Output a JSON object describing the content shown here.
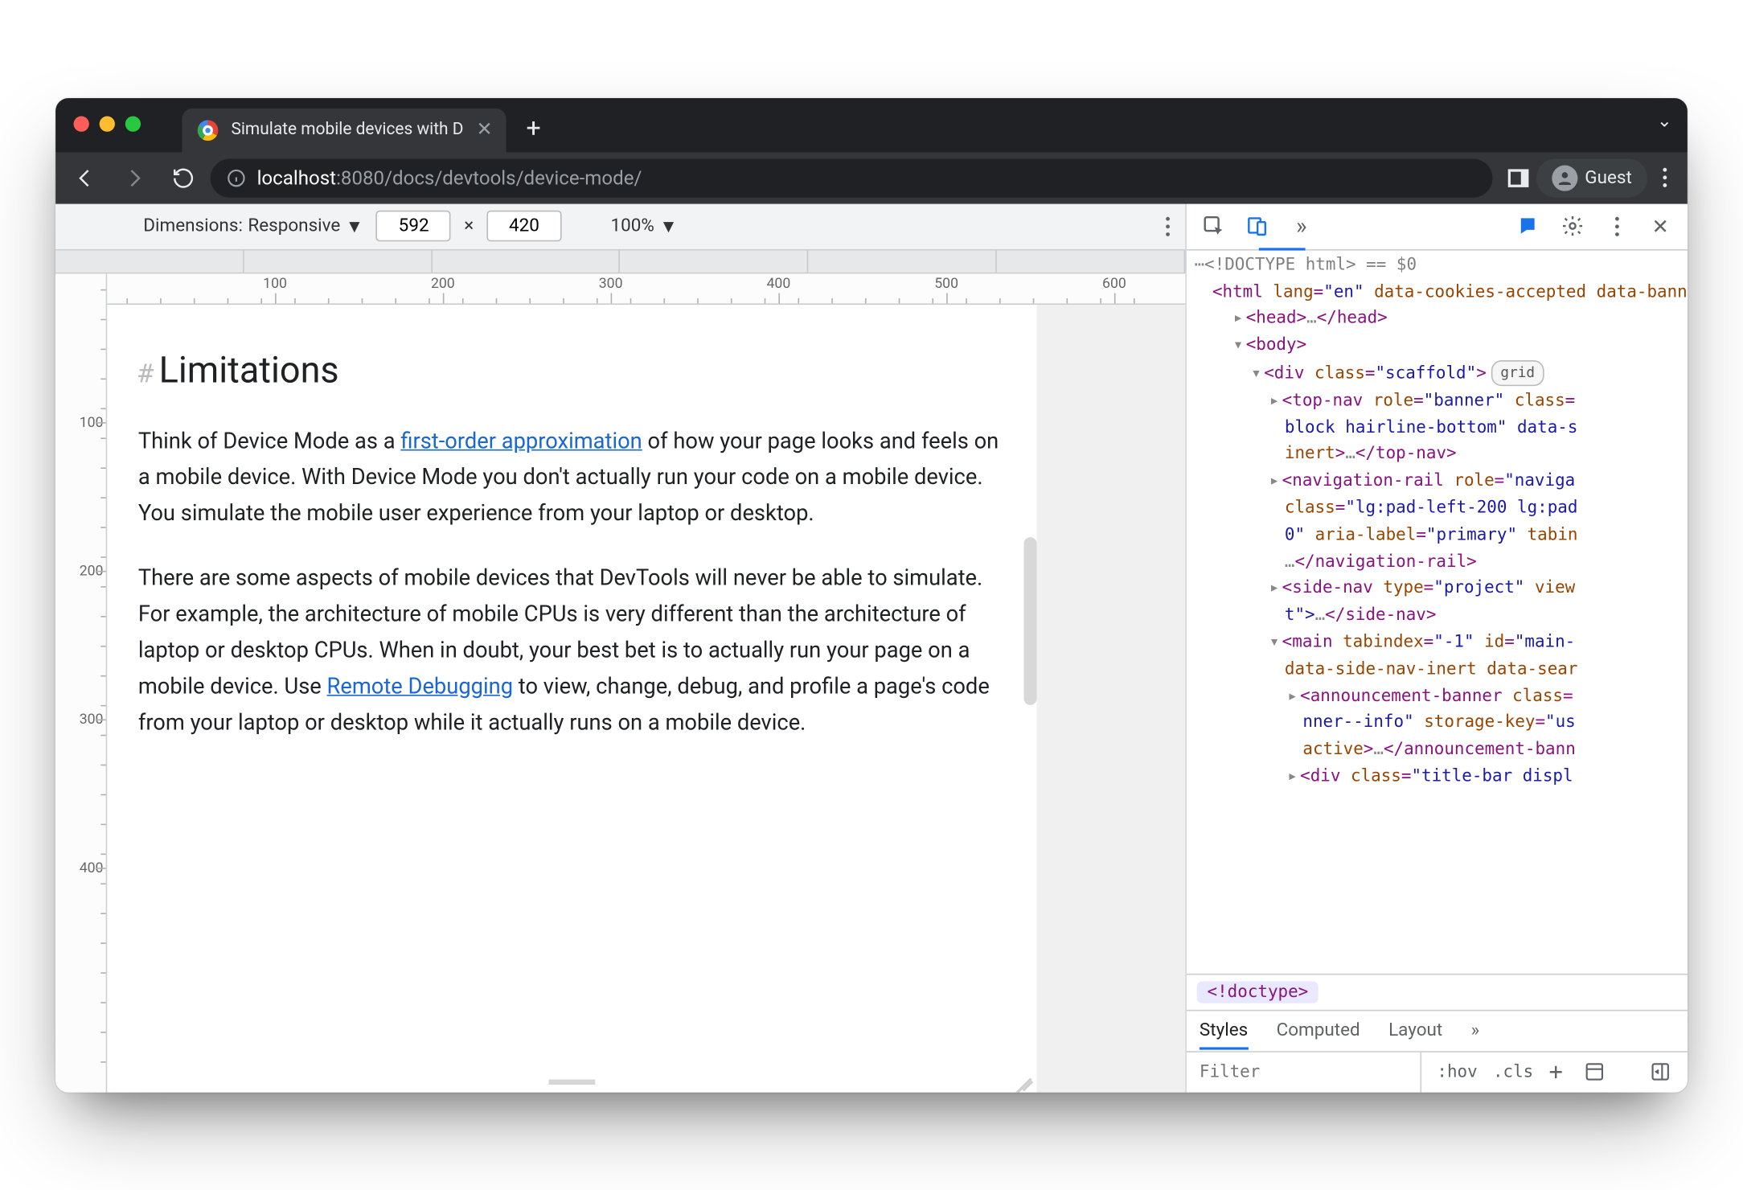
{
  "browser": {
    "tab_title": "Simulate mobile devices with D",
    "url_host": "localhost",
    "url_port": ":8080",
    "url_path": "/docs/devtools/device-mode/",
    "guest_label": "Guest"
  },
  "device_toolbar": {
    "dimensions_label": "Dimensions:",
    "dimensions_mode": "Responsive",
    "width": "592",
    "height": "420",
    "times": "×",
    "zoom": "100%"
  },
  "rulers": {
    "h": [
      "100",
      "200",
      "300",
      "400",
      "500",
      "600"
    ],
    "v": [
      "100",
      "200",
      "300",
      "400"
    ]
  },
  "page": {
    "heading": "Limitations",
    "hash": "#",
    "p1a": "Think of Device Mode as a ",
    "p1link": "first-order approximation",
    "p1b": " of how your page looks and feels on a mobile device. With Device Mode you don't actually run your code on a mobile device. You simulate the mobile user experience from your laptop or desktop.",
    "p2a": "There are some aspects of mobile devices that DevTools will never be able to simulate. For example, the architecture of mobile CPUs is very different than the architecture of laptop or desktop CPUs. When in doubt, your best bet is to actually run your page on a mobile device. Use ",
    "p2link": "Remote Debugging",
    "p2b": " to view, change, debug, and profile a page's code from your laptop or desktop while it actually runs on a mobile device."
  },
  "devtools": {
    "doctype_pre": "<!DOCTYPE html>",
    "eq_dollar": " == $0",
    "html_open_a": "<html ",
    "html_lang_attr": "lang",
    "html_lang_val": "\"en\"",
    "html_extra_attrs": " data-cookies-accepted data-banner-dismissed",
    "html_open_b": ">",
    "head_open": "<head>",
    "ellipsis": "…",
    "head_close": "</head>",
    "body_open": "<body>",
    "div_open_a": "<div ",
    "div_class_attr": "class",
    "div_class_val": "\"scaffold\"",
    "div_open_b": ">",
    "grid_badge": "grid",
    "topnav_a": "<top-nav ",
    "topnav_role_attr": "role",
    "topnav_role_val": "\"banner\"",
    "topnav_class_attr": " class",
    "topnav_cont": "block hairline-bottom\" data-s",
    "topnav_inert": "inert",
    "topnav_close": "</top-nav>",
    "navrail_a": "<navigation-rail ",
    "navrail_role_attr": "role",
    "navrail_role_val": "\"naviga",
    "navrail_class_attr": "class",
    "navrail_class_val": "\"lg:pad-left-200 lg:pad",
    "navrail_zero": "0\" ",
    "navrail_aria_attr": "aria-label",
    "navrail_aria_val": "\"primary\"",
    "navrail_tabin": " tabin",
    "navrail_close": "</navigation-rail>",
    "sidenav_a": "<side-nav ",
    "sidenav_type_attr": "type",
    "sidenav_type_val": "\"project\"",
    "sidenav_view": " view",
    "sidenav_t": "t\">",
    "sidenav_close": "</side-nav>",
    "main_a": "<main ",
    "main_tab_attr": "tabindex",
    "main_tab_val": "\"-1\"",
    "main_id_attr": " id",
    "main_id_val": "\"main-",
    "main_inert": "data-side-nav-inert data-sear",
    "ann_a": "<announcement-banner ",
    "ann_class_attr": "class",
    "ann_cont1": "nner--info\" ",
    "ann_storage_attr": "storage-key",
    "ann_storage_val": "\"us",
    "ann_active": "active",
    "ann_close": "</announcement-bann",
    "div2_a": "<div ",
    "div2_class_attr": "class",
    "div2_class_val": "\"title-bar displ",
    "breadcrumb": "<!doctype>",
    "styles_tab": "Styles",
    "computed_tab": "Computed",
    "layout_tab": "Layout",
    "filter_ph": "Filter",
    "hov": ":hov",
    "cls": ".cls"
  }
}
